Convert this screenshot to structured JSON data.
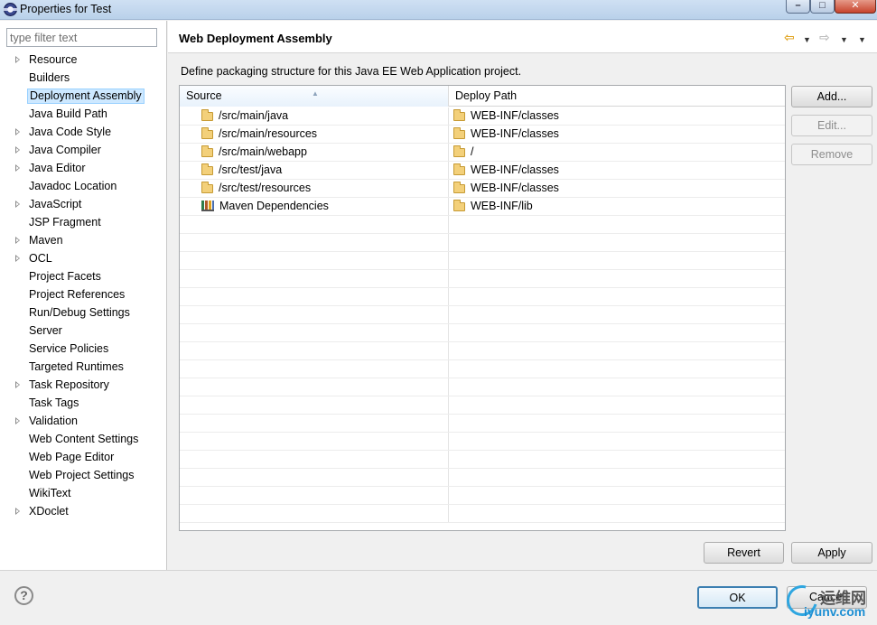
{
  "window": {
    "title": "Properties for Test",
    "minimize": "–",
    "maximize": "□",
    "close": "✕"
  },
  "filter": {
    "placeholder": "type filter text",
    "value": ""
  },
  "nav": {
    "items": [
      {
        "label": "Resource",
        "expandable": true
      },
      {
        "label": "Builders",
        "expandable": false
      },
      {
        "label": "Deployment Assembly",
        "expandable": false,
        "selected": true
      },
      {
        "label": "Java Build Path",
        "expandable": false
      },
      {
        "label": "Java Code Style",
        "expandable": true
      },
      {
        "label": "Java Compiler",
        "expandable": true
      },
      {
        "label": "Java Editor",
        "expandable": true
      },
      {
        "label": "Javadoc Location",
        "expandable": false
      },
      {
        "label": "JavaScript",
        "expandable": true
      },
      {
        "label": "JSP Fragment",
        "expandable": false
      },
      {
        "label": "Maven",
        "expandable": true
      },
      {
        "label": "OCL",
        "expandable": true
      },
      {
        "label": "Project Facets",
        "expandable": false
      },
      {
        "label": "Project References",
        "expandable": false
      },
      {
        "label": "Run/Debug Settings",
        "expandable": false
      },
      {
        "label": "Server",
        "expandable": false
      },
      {
        "label": "Service Policies",
        "expandable": false
      },
      {
        "label": "Targeted Runtimes",
        "expandable": false
      },
      {
        "label": "Task Repository",
        "expandable": true
      },
      {
        "label": "Task Tags",
        "expandable": false
      },
      {
        "label": "Validation",
        "expandable": true
      },
      {
        "label": "Web Content Settings",
        "expandable": false
      },
      {
        "label": "Web Page Editor",
        "expandable": false
      },
      {
        "label": "Web Project Settings",
        "expandable": false
      },
      {
        "label": "WikiText",
        "expandable": false
      },
      {
        "label": "XDoclet",
        "expandable": true
      }
    ]
  },
  "page": {
    "title": "Web Deployment Assembly",
    "description": "Define packaging structure for this Java EE Web Application project.",
    "toolbar": {
      "back_icon": "⇦",
      "forward_icon": "⇨",
      "menu_icon": "▼"
    }
  },
  "table": {
    "columns": {
      "source": "Source",
      "deploy": "Deploy Path"
    },
    "sort_indicator": "▲",
    "rows": [
      {
        "source": "/src/main/java",
        "source_icon": "folder-icon",
        "deploy": "WEB-INF/classes"
      },
      {
        "source": "/src/main/resources",
        "source_icon": "folder-icon",
        "deploy": "WEB-INF/classes"
      },
      {
        "source": "/src/main/webapp",
        "source_icon": "folder-icon",
        "deploy": "/"
      },
      {
        "source": "/src/test/java",
        "source_icon": "folder-icon",
        "deploy": "WEB-INF/classes"
      },
      {
        "source": "/src/test/resources",
        "source_icon": "folder-icon",
        "deploy": "WEB-INF/classes"
      },
      {
        "source": "Maven Dependencies",
        "source_icon": "library-icon",
        "deploy": "WEB-INF/lib"
      }
    ],
    "empty_rows": 17
  },
  "buttons": {
    "add": "Add...",
    "edit": "Edit...",
    "remove": "Remove",
    "revert": "Revert",
    "apply": "Apply",
    "ok": "OK",
    "cancel": "Cancel",
    "help": "?"
  },
  "watermark": {
    "title": "运维网",
    "url": "iyunv.com"
  }
}
